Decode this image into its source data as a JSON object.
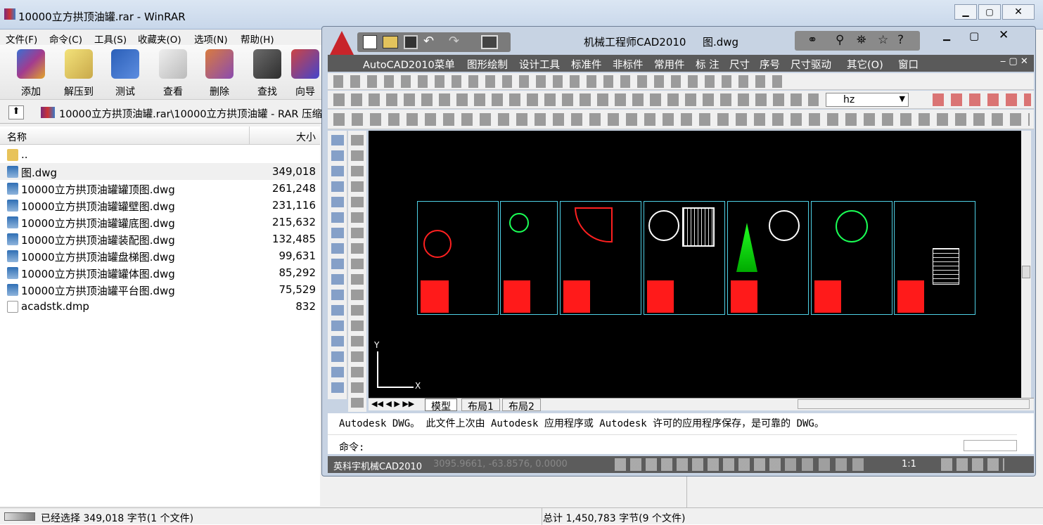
{
  "winrar": {
    "title": "10000立方拱顶油罐.rar - WinRAR",
    "menu": [
      "文件(F)",
      "命令(C)",
      "工具(S)",
      "收藏夹(O)",
      "选项(N)",
      "帮助(H)"
    ],
    "toolbar": [
      "添加",
      "解压到",
      "测试",
      "查看",
      "删除",
      "查找",
      "向导"
    ],
    "address": "10000立方拱顶油罐.rar\\10000立方拱顶油罐 - RAR 压缩",
    "columns": {
      "name": "名称",
      "size": "大小"
    },
    "files": [
      {
        "name": "..",
        "size": ""
      },
      {
        "name": "图.dwg",
        "size": "349,018"
      },
      {
        "name": "10000立方拱顶油罐罐顶图.dwg",
        "size": "261,248"
      },
      {
        "name": "10000立方拱顶油罐罐壁图.dwg",
        "size": "231,116"
      },
      {
        "name": "10000立方拱顶油罐罐底图.dwg",
        "size": "215,632"
      },
      {
        "name": "10000立方拱顶油罐装配图.dwg",
        "size": "132,485"
      },
      {
        "name": "10000立方拱顶油罐盘梯图.dwg",
        "size": "99,631"
      },
      {
        "name": "10000立方拱顶油罐罐体图.dwg",
        "size": "85,292"
      },
      {
        "name": "10000立方拱顶油罐平台图.dwg",
        "size": "75,529"
      },
      {
        "name": "acadstk.dmp",
        "size": "832"
      }
    ],
    "status_left": "已经选择 349,018 字节(1 个文件)",
    "status_right": "总计 1,450,783 字节(9 个文件)"
  },
  "cad": {
    "title": "机械工程师CAD2010",
    "doc": "图.dwg",
    "menu": [
      "AutoCAD2010菜单",
      "图形绘制",
      "设计工具",
      "标准件",
      "非标件",
      "常用件",
      "标 注",
      "尺寸",
      "序号",
      "尺寸驱动",
      "其它(O)",
      "窗口"
    ],
    "layer": "hz",
    "tabs": [
      "模型",
      "布局1",
      "布局2"
    ],
    "axis_x": "X",
    "axis_y": "Y",
    "cmd_line1": "Autodesk DWG。  此文件上次由 Autodesk 应用程序或 Autodesk 许可的应用程序保存，是可靠的 DWG。",
    "cmd_line2": "命令:",
    "status_app": "英科宇机械CAD2010",
    "coords": "3095.9661, -63.8576, 0.0000",
    "scale": "1:1"
  }
}
